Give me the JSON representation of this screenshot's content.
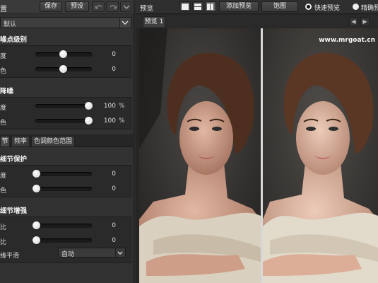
{
  "left_panel": {
    "title": "置",
    "buttons": {
      "save": "保存",
      "preset": "预设"
    },
    "preset_value": "默认",
    "sections": {
      "noise_level": {
        "title": "噪点级别",
        "rows": [
          {
            "label": "度",
            "value": "0"
          },
          {
            "label": "色",
            "value": "0"
          }
        ]
      },
      "denoise": {
        "title": "降噪",
        "rows": [
          {
            "label": "度",
            "value": "100",
            "unit": "%"
          },
          {
            "label": "色",
            "value": "100",
            "unit": "%"
          }
        ]
      },
      "tabs": [
        "节",
        "频率",
        "色调颜色范围"
      ],
      "detail_protect": {
        "title": "细节保护",
        "rows": [
          {
            "label": "度",
            "value": "0"
          },
          {
            "label": "色",
            "value": "0"
          }
        ]
      },
      "detail_enhance": {
        "title": "细节增强",
        "rows": [
          {
            "label": "比",
            "value": "0"
          },
          {
            "label": "比",
            "value": "0"
          }
        ],
        "smooth_label": "缘平滑",
        "smooth_value": "自动"
      }
    }
  },
  "right_panel": {
    "label": "预览",
    "add_preview": "添加预览",
    "snapshot": "饱图",
    "fast_preview": "快速预览",
    "precise_preview": "精确预",
    "preview_tab": "预览 1",
    "watermark": "www.mrgoat.cn"
  },
  "slider_levels": {
    "noise_level": [
      0.5,
      0.5
    ],
    "denoise": [
      1.0,
      1.0
    ],
    "detail_protect": [
      0.0,
      0.0
    ],
    "detail_enhance": [
      0.0,
      0.0
    ]
  }
}
